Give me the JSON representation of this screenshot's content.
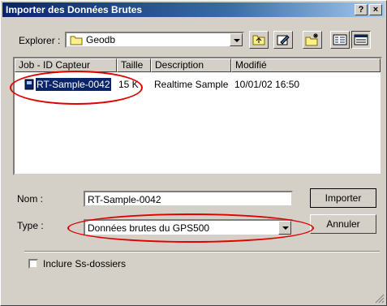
{
  "window": {
    "title": "Importer des Données Brutes",
    "help_btn": "?",
    "close_btn": "×"
  },
  "explorer": {
    "label": "Explorer :",
    "folder": "Geodb"
  },
  "list": {
    "columns": [
      "Job - ID Capteur",
      "Taille",
      "Description",
      "Modifié"
    ],
    "rows": [
      {
        "job": "RT-Sample-0042",
        "size": "15 K",
        "description": "Realtime Sample",
        "modified": "10/01/02 16:50"
      }
    ]
  },
  "form": {
    "name_label": "Nom :",
    "name_value": "RT-Sample-0042",
    "type_label": "Type :",
    "type_value": "Données brutes du GPS500",
    "import_button": "Importer",
    "cancel_button": "Annuler",
    "subfolders_label": "Inclure Ss-dossiers",
    "subfolders_checked": false
  },
  "colors": {
    "title_start": "#0a246a",
    "title_end": "#a6caf0",
    "selection": "#0a246a",
    "annotation": "#e00000"
  }
}
